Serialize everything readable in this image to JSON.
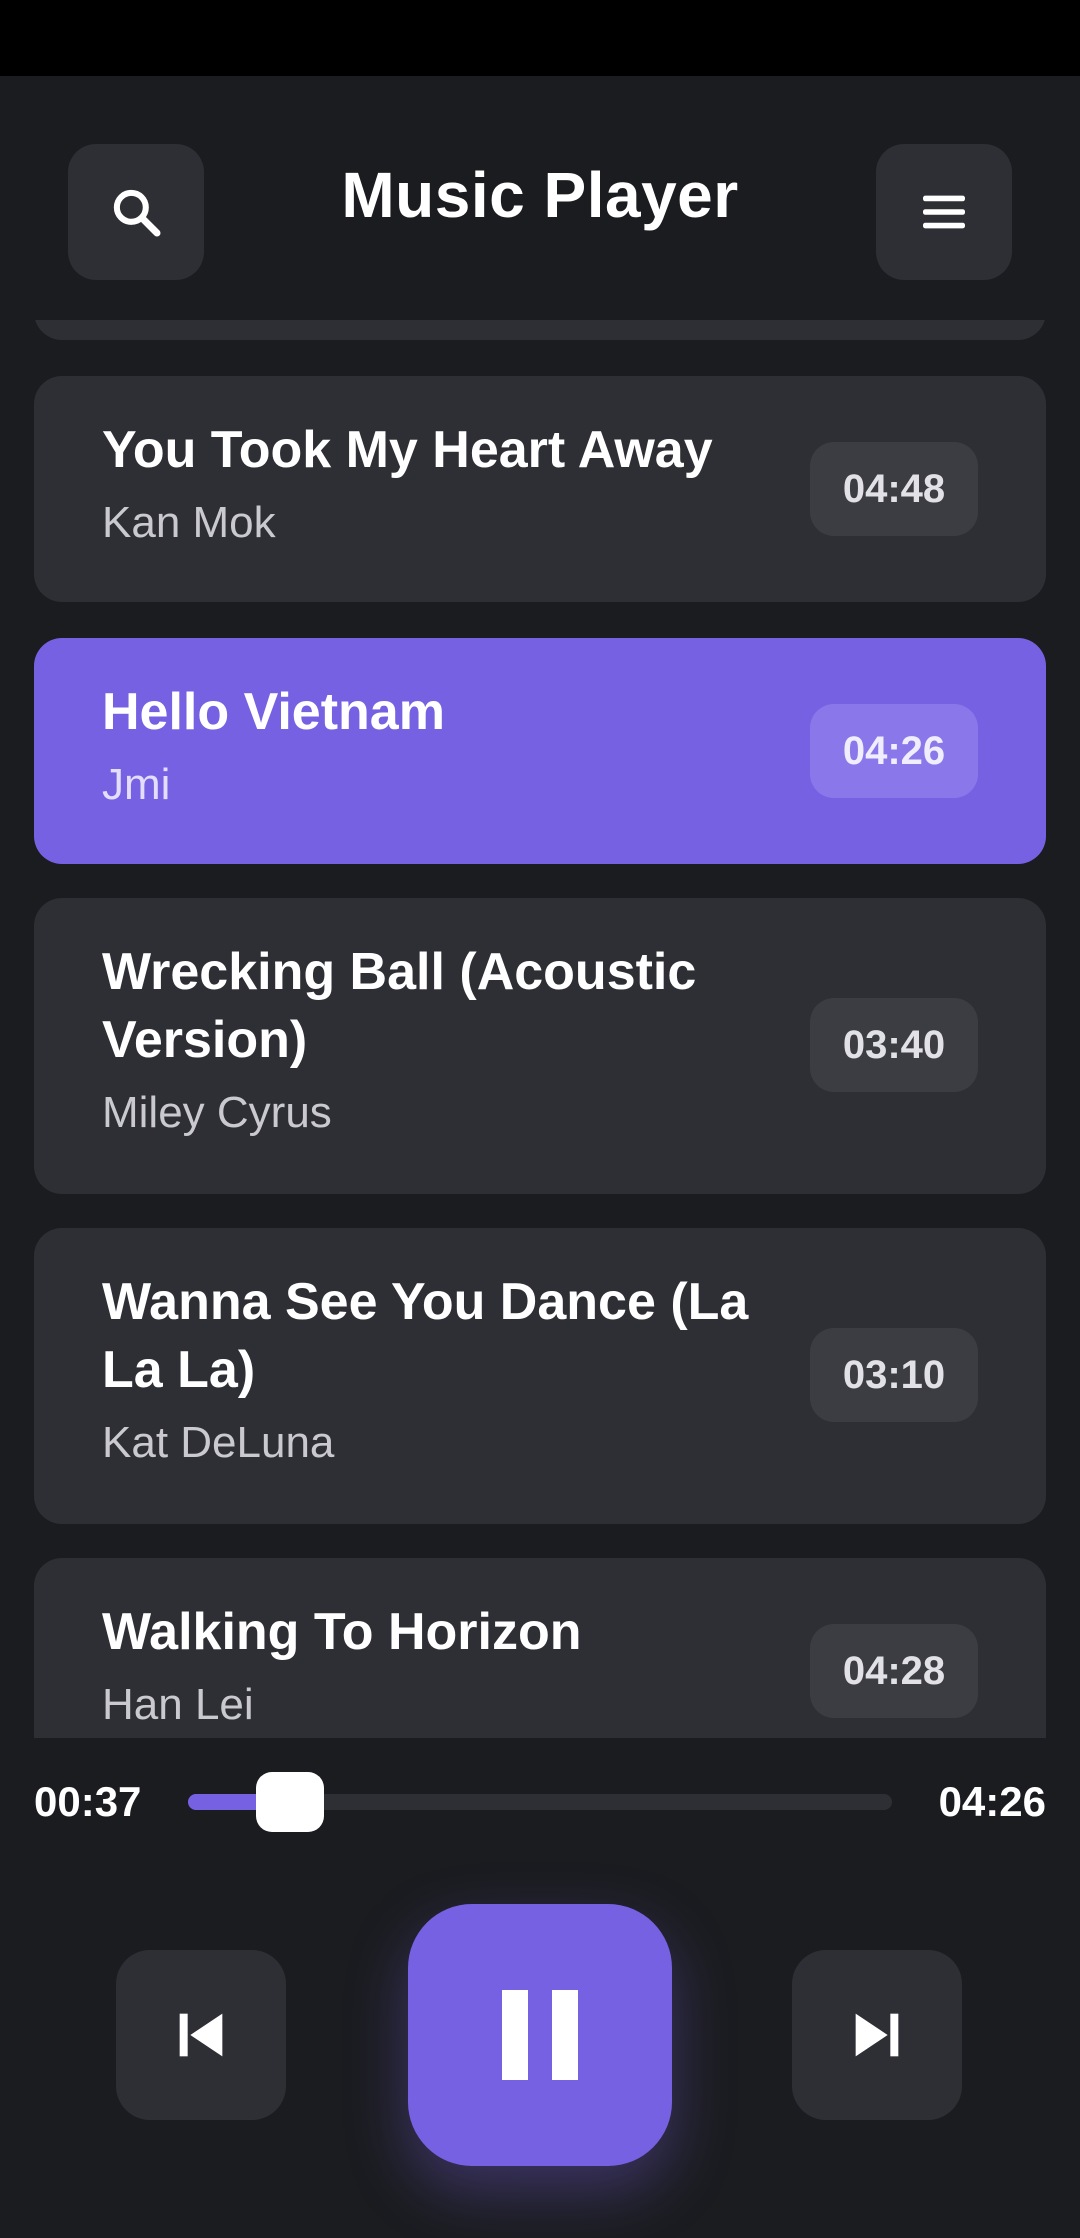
{
  "header": {
    "title": "Music Player",
    "search_icon": "search-icon",
    "menu_icon": "menu-icon"
  },
  "songs": [
    {
      "title": "You Took My Heart Away",
      "artist": "Kan Mok",
      "duration": "04:48",
      "active": false
    },
    {
      "title": "Hello Vietnam",
      "artist": "Jmi",
      "duration": "04:26",
      "active": true
    },
    {
      "title": "Wrecking Ball (Acoustic Version)",
      "artist": "Miley Cyrus",
      "duration": "03:40",
      "active": false
    },
    {
      "title": "Wanna See You Dance (La La La)",
      "artist": "Kat DeLuna",
      "duration": "03:10",
      "active": false
    },
    {
      "title": "Walking To Horizon",
      "artist": "Han Lei",
      "duration": "04:28",
      "active": false
    }
  ],
  "player": {
    "elapsed": "00:37",
    "total": "04:26",
    "progress_fraction": 0.145,
    "state": "playing",
    "prev_icon": "skip-previous-icon",
    "play_icon": "pause-icon",
    "next_icon": "skip-next-icon"
  },
  "colors": {
    "accent": "#7761e3",
    "background": "#1b1c20",
    "card": "#2e2f35"
  }
}
